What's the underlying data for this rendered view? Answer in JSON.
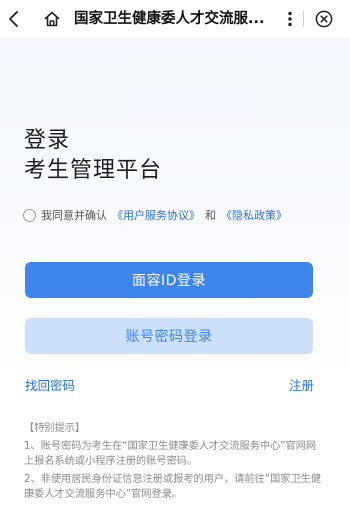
{
  "topbar": {
    "title": "国家卫生健康委人才交流服...",
    "back_icon": "chevron-left-icon",
    "home_icon": "home-icon",
    "more_icon": "more-vertical-icon",
    "close_icon": "close-circle-icon"
  },
  "login": {
    "heading_line1": "登录",
    "heading_line2": "考生管理平台",
    "agree": {
      "prefix": "我同意并确认",
      "user_agreement": "《用户服务协议》",
      "and": "和",
      "privacy_policy": "《隐私政策》"
    },
    "face_login_label": "面容ID登录",
    "password_login_label": "账号密码登录",
    "recover_password_label": "找回密码",
    "register_label": "注册"
  },
  "tips": {
    "title": "【特别提示】",
    "item1": "1、账号密码为考生在“国家卫生健康委人才交流服务中心”官网网上报名系统或小程序注册的账号密码。",
    "item2": "2、非使用居民身份证信息注册或报考的用户，请前往“国家卫生健康委人才交流服务中心”官网登录。"
  },
  "colors": {
    "accent": "#3d84ec",
    "accent_light": "#cde0fb",
    "link": "#2b6fd8"
  }
}
